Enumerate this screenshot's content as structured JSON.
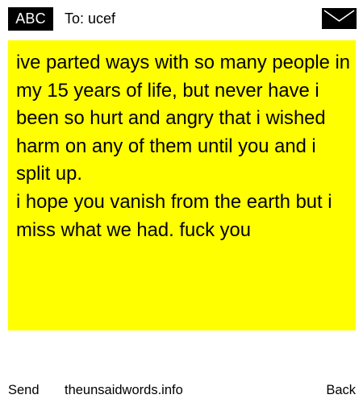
{
  "header": {
    "input_mode": "ABC",
    "to_label": "To: ucef",
    "icon": "envelope-icon"
  },
  "message": {
    "body": "ive parted ways with so many people in my 15 years of life, but never have i been so hurt and angry that i wished harm on any of them until you and i split up.\ni hope you vanish from the earth but i miss what we had. fuck you"
  },
  "footer": {
    "send_label": "Send",
    "site_label": "theunsaidwords.info",
    "back_label": "Back"
  },
  "colors": {
    "message_background": "#ffff00",
    "badge_background": "#000000",
    "badge_text": "#ffffff"
  }
}
